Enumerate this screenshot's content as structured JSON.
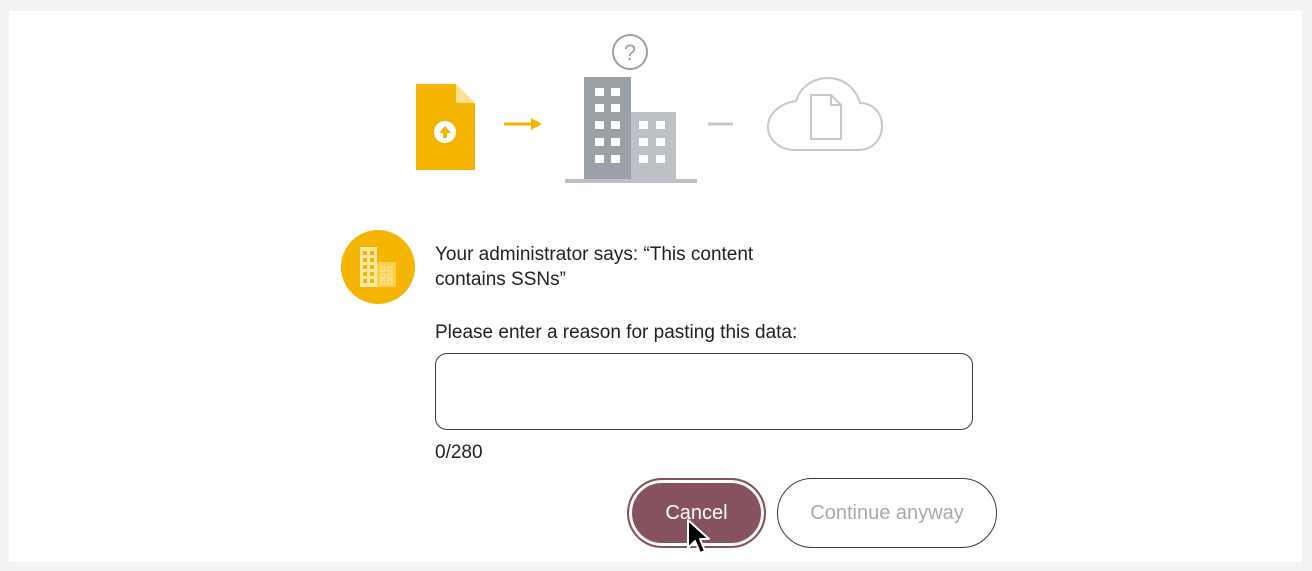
{
  "admin": {
    "message_line1": "Your administrator says: “This content",
    "message_line2": "contains SSNs”"
  },
  "form": {
    "reason_label": "Please enter a reason for pasting this data:",
    "reason_value": "",
    "char_counter": "0/280"
  },
  "buttons": {
    "cancel_label": "Cancel",
    "continue_label": "Continue anyway"
  },
  "icons": {
    "file": "upload-file-icon",
    "arrow": "arrow-right-icon",
    "building": "organization-building-icon",
    "question": "question-mark-icon",
    "cloud": "cloud-file-icon",
    "avatar": "organization-avatar-icon",
    "cursor": "mouse-pointer-icon"
  },
  "colors": {
    "accent": "#f5b400",
    "cancel_button": "#86525f",
    "building_dark": "#9aa0a6",
    "building_light": "#bdc1c6",
    "cloud_outline": "#c8c8c8",
    "disabled_text": "#a9a9a9"
  }
}
